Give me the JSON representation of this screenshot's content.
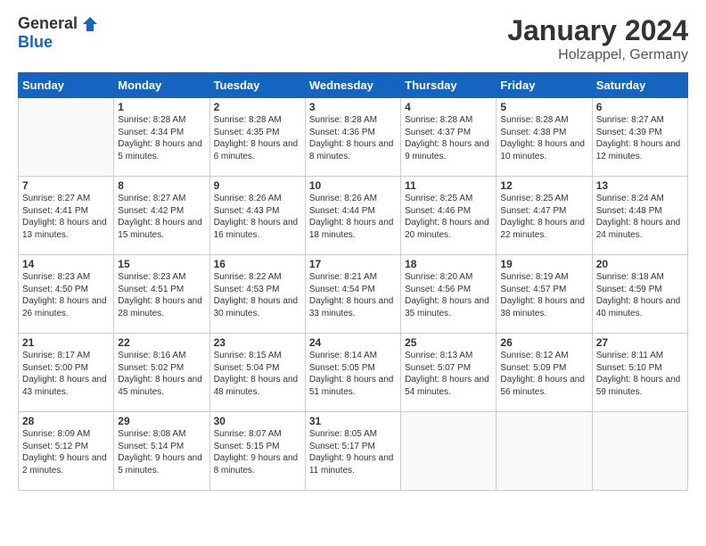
{
  "header": {
    "logo_general": "General",
    "logo_blue": "Blue",
    "month_title": "January 2024",
    "location": "Holzappel, Germany"
  },
  "days_of_week": [
    "Sunday",
    "Monday",
    "Tuesday",
    "Wednesday",
    "Thursday",
    "Friday",
    "Saturday"
  ],
  "weeks": [
    [
      {
        "day": "",
        "info": ""
      },
      {
        "day": "1",
        "info": "Sunrise: 8:28 AM\nSunset: 4:34 PM\nDaylight: 8 hours\nand 5 minutes."
      },
      {
        "day": "2",
        "info": "Sunrise: 8:28 AM\nSunset: 4:35 PM\nDaylight: 8 hours\nand 6 minutes."
      },
      {
        "day": "3",
        "info": "Sunrise: 8:28 AM\nSunset: 4:36 PM\nDaylight: 8 hours\nand 8 minutes."
      },
      {
        "day": "4",
        "info": "Sunrise: 8:28 AM\nSunset: 4:37 PM\nDaylight: 8 hours\nand 9 minutes."
      },
      {
        "day": "5",
        "info": "Sunrise: 8:28 AM\nSunset: 4:38 PM\nDaylight: 8 hours\nand 10 minutes."
      },
      {
        "day": "6",
        "info": "Sunrise: 8:27 AM\nSunset: 4:39 PM\nDaylight: 8 hours\nand 12 minutes."
      }
    ],
    [
      {
        "day": "7",
        "info": ""
      },
      {
        "day": "8",
        "info": "Sunrise: 8:27 AM\nSunset: 4:42 PM\nDaylight: 8 hours\nand 15 minutes."
      },
      {
        "day": "9",
        "info": "Sunrise: 8:26 AM\nSunset: 4:43 PM\nDaylight: 8 hours\nand 16 minutes."
      },
      {
        "day": "10",
        "info": "Sunrise: 8:26 AM\nSunset: 4:44 PM\nDaylight: 8 hours\nand 18 minutes."
      },
      {
        "day": "11",
        "info": "Sunrise: 8:25 AM\nSunset: 4:46 PM\nDaylight: 8 hours\nand 20 minutes."
      },
      {
        "day": "12",
        "info": "Sunrise: 8:25 AM\nSunset: 4:47 PM\nDaylight: 8 hours\nand 22 minutes."
      },
      {
        "day": "13",
        "info": "Sunrise: 8:24 AM\nSunset: 4:48 PM\nDaylight: 8 hours\nand 24 minutes."
      }
    ],
    [
      {
        "day": "14",
        "info": ""
      },
      {
        "day": "15",
        "info": "Sunrise: 8:23 AM\nSunset: 4:51 PM\nDaylight: 8 hours\nand 28 minutes."
      },
      {
        "day": "16",
        "info": "Sunrise: 8:22 AM\nSunset: 4:53 PM\nDaylight: 8 hours\nand 30 minutes."
      },
      {
        "day": "17",
        "info": "Sunrise: 8:21 AM\nSunset: 4:54 PM\nDaylight: 8 hours\nand 33 minutes."
      },
      {
        "day": "18",
        "info": "Sunrise: 8:20 AM\nSunset: 4:56 PM\nDaylight: 8 hours\nand 35 minutes."
      },
      {
        "day": "19",
        "info": "Sunrise: 8:19 AM\nSunset: 4:57 PM\nDaylight: 8 hours\nand 38 minutes."
      },
      {
        "day": "20",
        "info": "Sunrise: 8:18 AM\nSunset: 4:59 PM\nDaylight: 8 hours\nand 40 minutes."
      }
    ],
    [
      {
        "day": "21",
        "info": ""
      },
      {
        "day": "22",
        "info": "Sunrise: 8:16 AM\nSunset: 5:02 PM\nDaylight: 8 hours\nand 45 minutes."
      },
      {
        "day": "23",
        "info": "Sunrise: 8:15 AM\nSunset: 5:04 PM\nDaylight: 8 hours\nand 48 minutes."
      },
      {
        "day": "24",
        "info": "Sunrise: 8:14 AM\nSunset: 5:05 PM\nDaylight: 8 hours\nand 51 minutes."
      },
      {
        "day": "25",
        "info": "Sunrise: 8:13 AM\nSunset: 5:07 PM\nDaylight: 8 hours\nand 54 minutes."
      },
      {
        "day": "26",
        "info": "Sunrise: 8:12 AM\nSunset: 5:09 PM\nDaylight: 8 hours\nand 56 minutes."
      },
      {
        "day": "27",
        "info": "Sunrise: 8:11 AM\nSunset: 5:10 PM\nDaylight: 8 hours\nand 59 minutes."
      }
    ],
    [
      {
        "day": "28",
        "info": "Sunrise: 8:09 AM\nSunset: 5:12 PM\nDaylight: 9 hours\nand 2 minutes."
      },
      {
        "day": "29",
        "info": "Sunrise: 8:08 AM\nSunset: 5:14 PM\nDaylight: 9 hours\nand 5 minutes."
      },
      {
        "day": "30",
        "info": "Sunrise: 8:07 AM\nSunset: 5:15 PM\nDaylight: 9 hours\nand 8 minutes."
      },
      {
        "day": "31",
        "info": "Sunrise: 8:05 AM\nSunset: 5:17 PM\nDaylight: 9 hours\nand 11 minutes."
      },
      {
        "day": "",
        "info": ""
      },
      {
        "day": "",
        "info": ""
      },
      {
        "day": "",
        "info": ""
      }
    ]
  ],
  "week1_sun_info": "Sunrise: 8:27 AM\nSunset: 4:41 PM\nDaylight: 8 hours\nand 13 minutes.",
  "week2_sun_info": "Sunrise: 8:23 AM\nSunset: 4:50 PM\nDaylight: 8 hours\nand 26 minutes.",
  "week3_sun_info": "Sunrise: 8:17 AM\nSunset: 5:00 PM\nDaylight: 8 hours\nand 43 minutes."
}
